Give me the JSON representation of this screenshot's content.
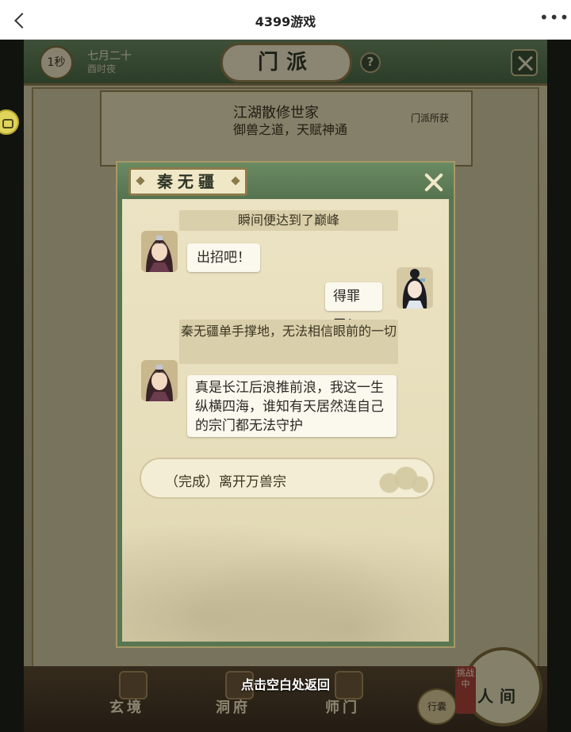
{
  "browser": {
    "title": "4399游戏",
    "back_icon": "chevron-left-icon",
    "more_icon": "more-dots-icon",
    "more_glyph": "•••"
  },
  "game": {
    "header": {
      "timer": "1秒",
      "date_line1": "七月二十",
      "date_line2": "酉时夜",
      "title": "门派",
      "help": "?"
    },
    "background_card": {
      "title": "江湖散修世家",
      "subtitle": "御兽之道，天赋神通",
      "right_label": "门派所获"
    },
    "bottom_nav": {
      "items": [
        "玄境",
        "洞府",
        "师门"
      ],
      "challenge_badge": "挑战中",
      "bag_label": "行囊",
      "world_label": "人间"
    },
    "tap_hint": "点击空白处返回"
  },
  "dialog": {
    "speaker_name": "秦无疆",
    "close_icon": "close-icon",
    "messages": [
      {
        "type": "narration",
        "text": "瞬间便达到了巅峰"
      },
      {
        "type": "npc",
        "text": "出招吧！"
      },
      {
        "type": "player",
        "text": "得罪了！"
      },
      {
        "type": "narration",
        "text": "秦无疆单手撑地，无法相信眼前的一切"
      },
      {
        "type": "npc",
        "text": "真是长江后浪推前浪，我这一生纵横四海，谁知有天居然连自己的宗门都无法守护"
      }
    ],
    "choice": "（完成）离开万兽宗"
  },
  "colors": {
    "frame_green": "#597652",
    "parchment": "#ebe2c1",
    "bubble": "#fbf8ee",
    "narration_bg": "#d9cfaa"
  }
}
